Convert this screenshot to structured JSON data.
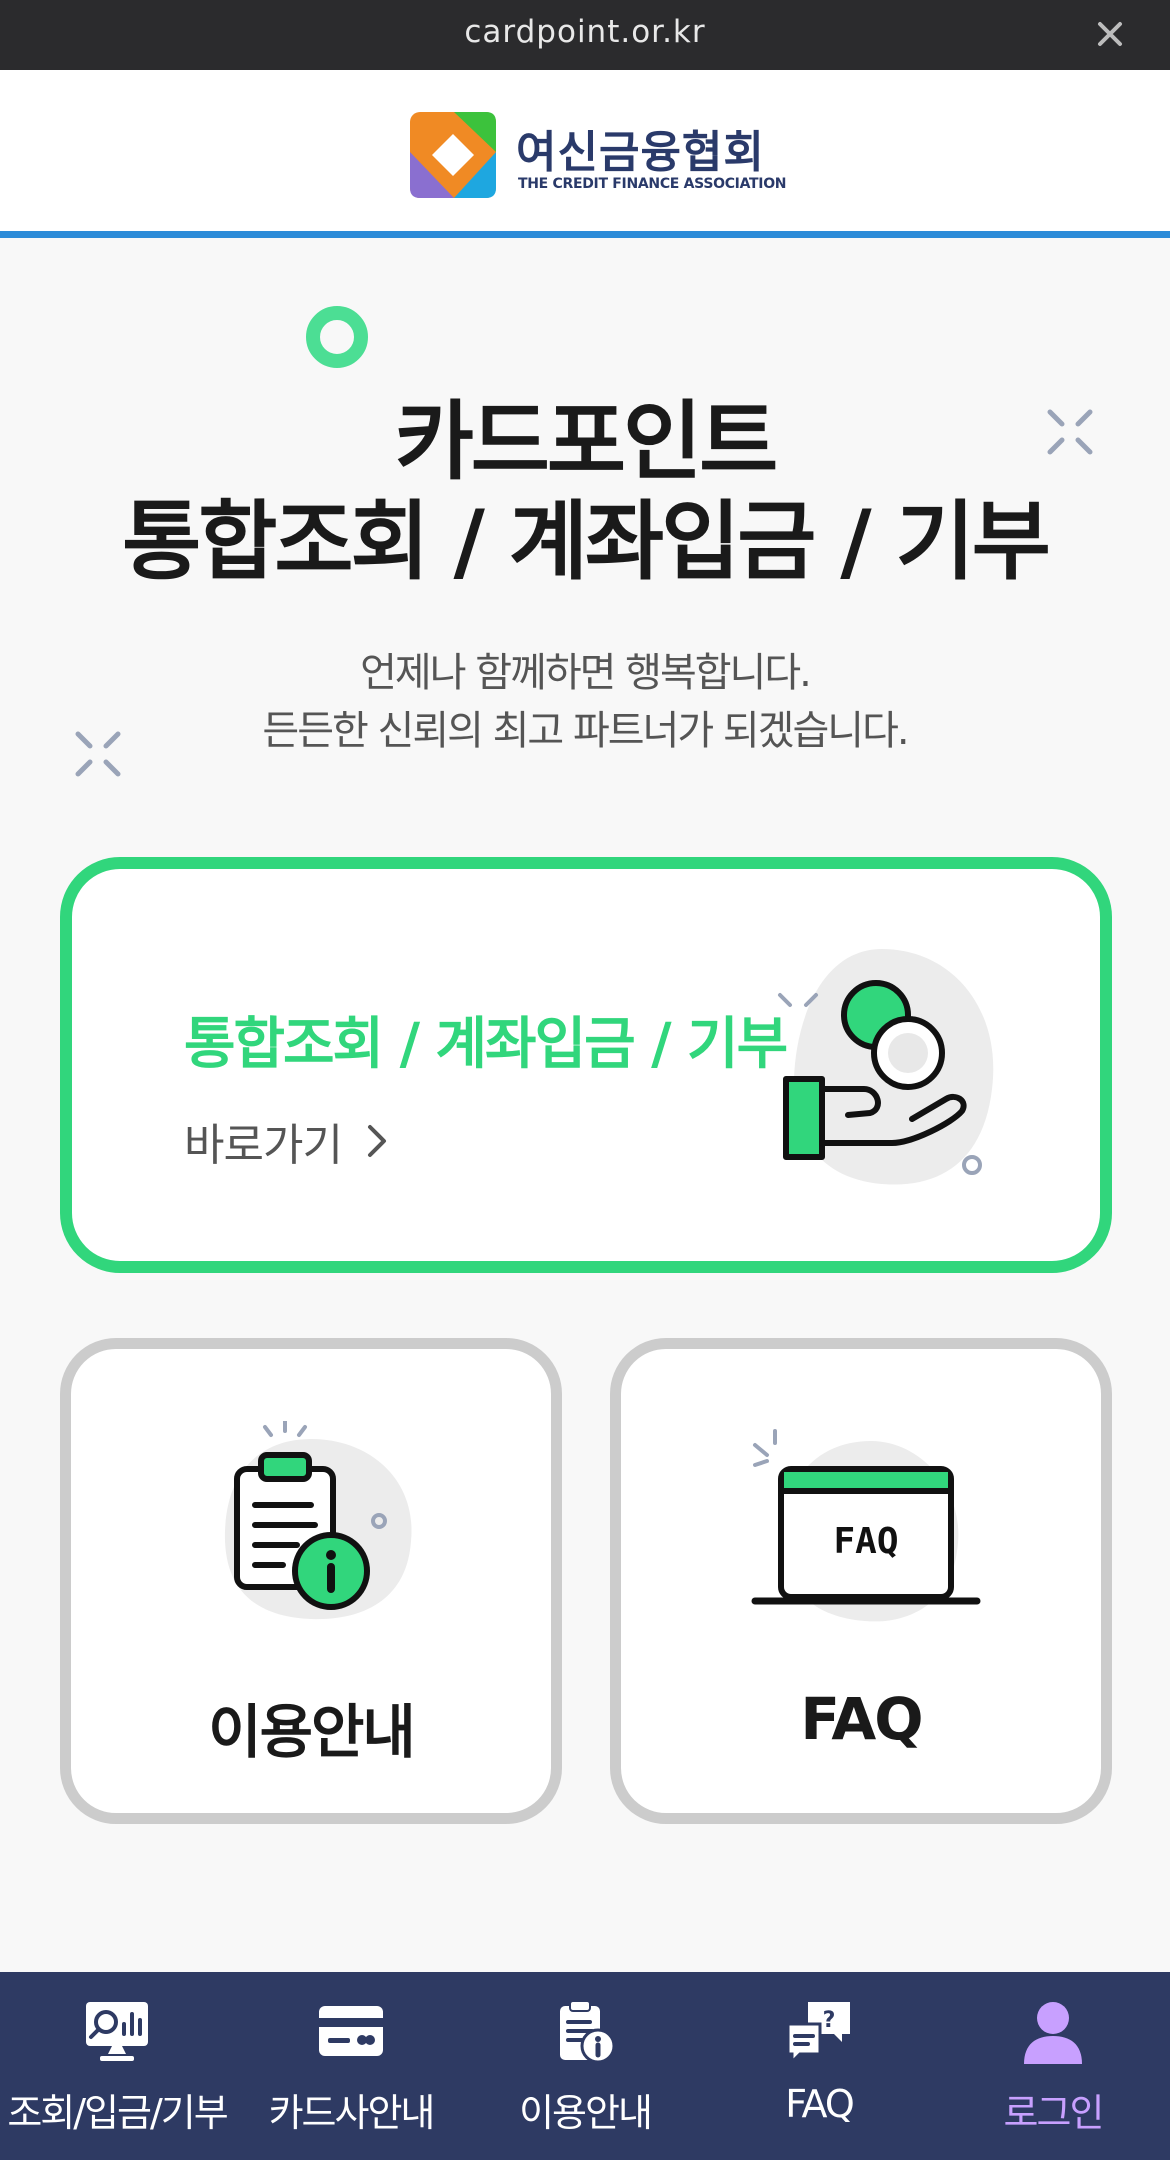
{
  "browser": {
    "url": "cardpoint.or.kr",
    "close_icon": "close-icon"
  },
  "header": {
    "logo_name": "여신금융협회",
    "logo_sub": "THE CREDIT FINANCE ASSOCIATION"
  },
  "hero": {
    "title_line1": "카드포인트",
    "title_line2": "통합조회 / 계좌입금 / 기부",
    "subtitle_line1": "언제나 함께하면 행복합니다.",
    "subtitle_line2": "든든한 신뢰의 최고 파트너가 되겠습니다."
  },
  "main_card": {
    "title": "통합조회 / 계좌입금 / 기부",
    "link_label": "바로가기",
    "icon": "coin-hand-icon"
  },
  "cards": [
    {
      "label": "이용안내",
      "icon": "clipboard-info-icon"
    },
    {
      "label": "FAQ",
      "icon": "faq-laptop-icon"
    }
  ],
  "tabbar": {
    "items": [
      {
        "label": "조회/입금/기부",
        "icon": "search-chart-icon"
      },
      {
        "label": "카드사안내",
        "icon": "credit-card-icon"
      },
      {
        "label": "이용안내",
        "icon": "clipboard-info-icon"
      },
      {
        "label": "FAQ",
        "icon": "faq-chat-icon"
      },
      {
        "label": "로그인",
        "icon": "user-icon"
      }
    ],
    "active_index": 4
  },
  "colors": {
    "accent_green": "#31d67c",
    "header_blue": "#2c8bd8",
    "tabbar_bg": "#2e3a63",
    "active_tab": "#c8a0ff"
  }
}
